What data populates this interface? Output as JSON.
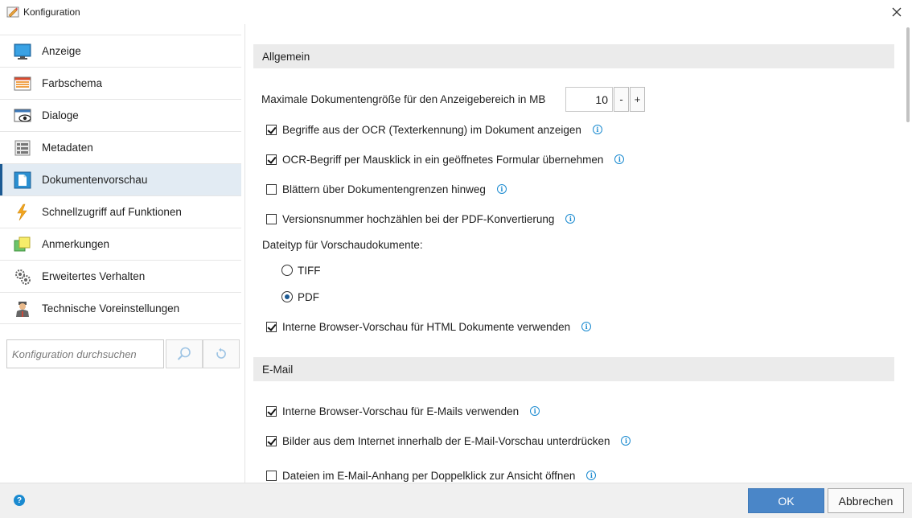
{
  "window": {
    "title": "Konfiguration",
    "app_icon": "config-app-icon",
    "close_icon": "close-icon"
  },
  "sidebar": {
    "items": [
      {
        "label": "Anzeige",
        "icon": "monitor-icon",
        "active": false
      },
      {
        "label": "Farbschema",
        "icon": "color-scheme-icon",
        "active": false
      },
      {
        "label": "Dialoge",
        "icon": "dialog-eye-icon",
        "active": false
      },
      {
        "label": "Metadaten",
        "icon": "metadata-list-icon",
        "active": false
      },
      {
        "label": "Dokumentenvorschau",
        "icon": "document-preview-icon",
        "active": true
      },
      {
        "label": "Schnellzugriff auf Funktionen",
        "icon": "lightning-icon",
        "active": false
      },
      {
        "label": "Anmerkungen",
        "icon": "notes-icon",
        "active": false
      },
      {
        "label": "Erweitertes Verhalten",
        "icon": "gears-icon",
        "active": false
      },
      {
        "label": "Technische Voreinstellungen",
        "icon": "technician-icon",
        "active": false
      }
    ],
    "search": {
      "placeholder": "Konfiguration durchsuchen",
      "search_icon": "search-icon",
      "reset_icon": "reset-icon"
    }
  },
  "main": {
    "sections": {
      "general": {
        "header": "Allgemein",
        "max_size_label": "Maximale Dokumentengröße für den Anzeigebereich in MB",
        "max_size_value": "10",
        "minus_label": "-",
        "plus_label": "+",
        "options": [
          {
            "label": "Begriffe aus der OCR (Texterkennung) im Dokument anzeigen",
            "checked": true
          },
          {
            "label": "OCR-Begriff per Mausklick in ein geöffnetes Formular übernehmen",
            "checked": true
          },
          {
            "label": "Blättern über Dokumentengrenzen hinweg",
            "checked": false
          },
          {
            "label": "Versionsnummer hochzählen bei der PDF-Konvertierung",
            "checked": false
          }
        ],
        "filetype_label": "Dateityp für Vorschaudokumente:",
        "filetypes": [
          {
            "label": "TIFF",
            "selected": false
          },
          {
            "label": "PDF",
            "selected": true
          }
        ],
        "html_preview": {
          "label": "Interne Browser-Vorschau für HTML Dokumente verwenden",
          "checked": true
        }
      },
      "email": {
        "header": "E-Mail",
        "options": [
          {
            "label": "Interne Browser-Vorschau für E-Mails verwenden",
            "checked": true
          },
          {
            "label": "Bilder aus dem Internet innerhalb der E-Mail-Vorschau unterdrücken",
            "checked": true
          },
          {
            "label": "Dateien im E-Mail-Anhang per Doppelklick zur Ansicht öffnen",
            "checked": false
          }
        ]
      }
    },
    "info_icon": "info-icon"
  },
  "footer": {
    "help_icon": "help-icon",
    "ok_label": "OK",
    "cancel_label": "Abbrechen"
  },
  "colors": {
    "accent": "#1c5a93",
    "active_bg": "#e2ebf3",
    "primary_button": "#4a86c8",
    "info_blue": "#1a8ad0"
  }
}
